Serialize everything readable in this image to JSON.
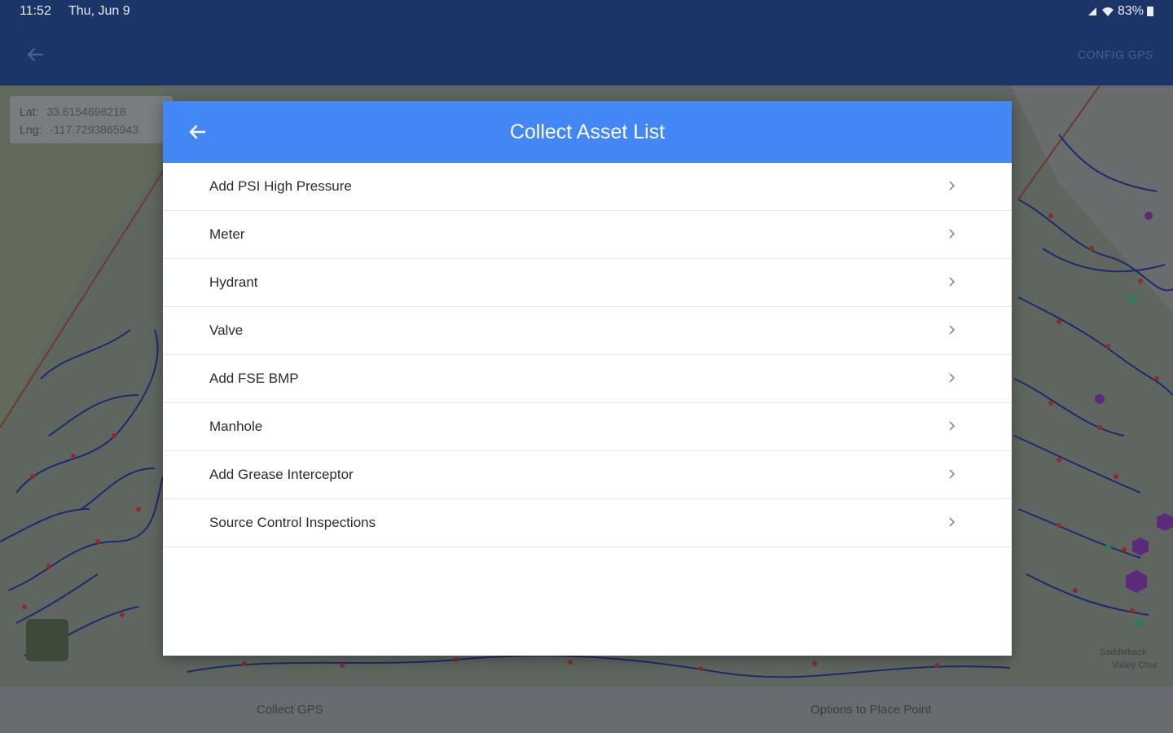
{
  "status_bar": {
    "time": "11:52",
    "date": "Thu, Jun 9",
    "battery": "83%",
    "icons": [
      "signal-icon",
      "wifi-icon",
      "battery-icon"
    ]
  },
  "app_bar": {
    "back_icon": "arrow-left-icon",
    "action_label": "CONFIG GPS"
  },
  "map": {
    "lat_label": "Lat:",
    "lat_value": "33.6154698218",
    "lng_label": "Lng:",
    "lng_value": "-117.7293865943",
    "labels": [
      "Saddleback",
      "Valley Chur"
    ]
  },
  "dialog": {
    "title": "Collect Asset List",
    "back_icon": "arrow-left-icon",
    "items": [
      {
        "label": "Add PSI High Pressure"
      },
      {
        "label": "Meter"
      },
      {
        "label": "Hydrant"
      },
      {
        "label": "Valve"
      },
      {
        "label": "Add FSE BMP"
      },
      {
        "label": "Manhole"
      },
      {
        "label": "Add Grease Interceptor"
      },
      {
        "label": "Source Control Inspections"
      }
    ],
    "colors": {
      "header": "#4287f5",
      "background": "#ffffff"
    }
  },
  "bottom_bar": {
    "left_label": "Collect GPS",
    "right_label": "Options to Place Point"
  },
  "theme": {
    "app_bar": "#1c3568"
  }
}
